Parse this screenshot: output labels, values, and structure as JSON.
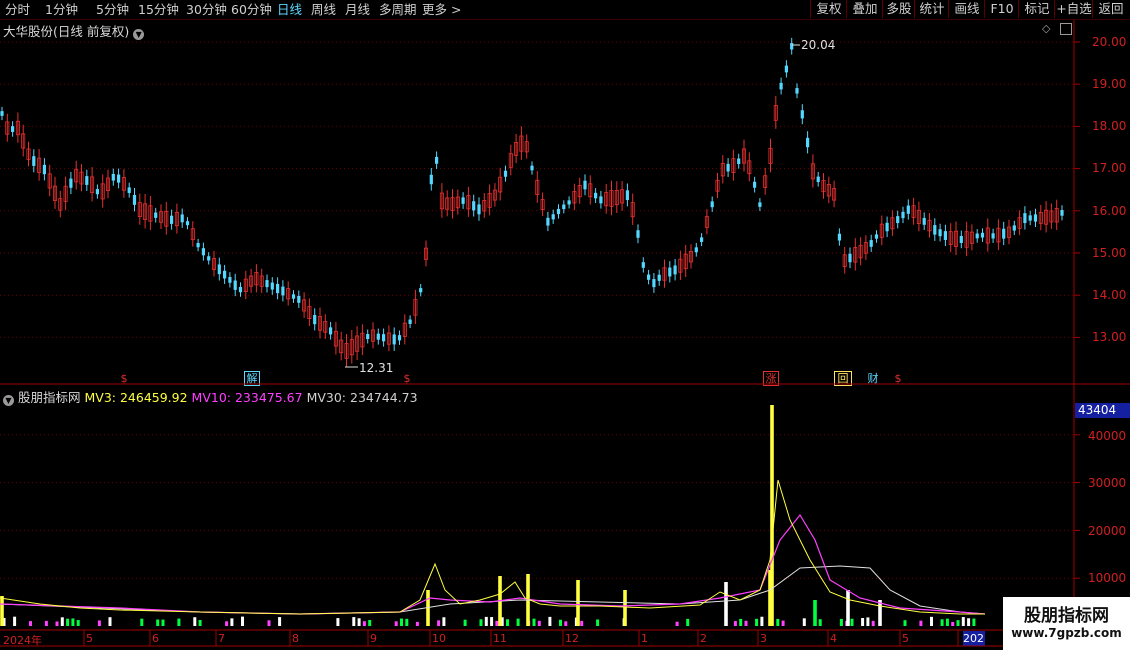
{
  "toolbar": {
    "periods": [
      "分时",
      "1分钟",
      "5分钟",
      "15分钟",
      "30分钟",
      "60分钟",
      "日线",
      "周线",
      "月线",
      "多周期",
      "更多 >"
    ],
    "active_period": "日线",
    "right_buttons": [
      "复权",
      "叠加",
      "多股",
      "统计",
      "画线",
      "F10",
      "标记",
      "+自选",
      "返回"
    ]
  },
  "main_chart": {
    "title": "大华股份(日线 前复权)",
    "high_label": "20.04",
    "low_label": "12.31",
    "price_ticks": [
      "20.00",
      "19.00",
      "18.00",
      "17.00",
      "16.00",
      "15.00",
      "14.00",
      "13.00"
    ],
    "events": [
      {
        "label": "$",
        "color": "#e03030"
      },
      {
        "label": "解",
        "color": "#5fd8ff"
      },
      {
        "label": "$",
        "color": "#e03030"
      },
      {
        "label": "涨",
        "color": "#e03030"
      },
      {
        "label": "回",
        "color": "#ffe060"
      },
      {
        "label": "财",
        "color": "#5fd8ff"
      },
      {
        "label": "$",
        "color": "#e03030"
      }
    ]
  },
  "volume_chart": {
    "title": "股朋指标网",
    "mv3_label": "MV3: 246459.92",
    "mv10_label": "MV10: 233475.67",
    "mv30_label": "MV30: 234744.73",
    "current_value": "43404",
    "ticks": [
      "40000",
      "30000",
      "20000",
      "10000"
    ]
  },
  "x_axis": {
    "labels": [
      "2024年",
      "5",
      "6",
      "7",
      "8",
      "9",
      "10",
      "11",
      "12",
      "1",
      "2",
      "3",
      "4",
      "5",
      "202"
    ]
  },
  "watermark": {
    "line1": "股朋指标网",
    "line2": "www.7gpzb.com"
  },
  "colors": {
    "up": "#e83030",
    "down": "#54d8ff",
    "mv3": "#ffff40",
    "mv10": "#ff40ff",
    "mv30": "#e0e0e0",
    "grid": "#6a0000"
  }
}
